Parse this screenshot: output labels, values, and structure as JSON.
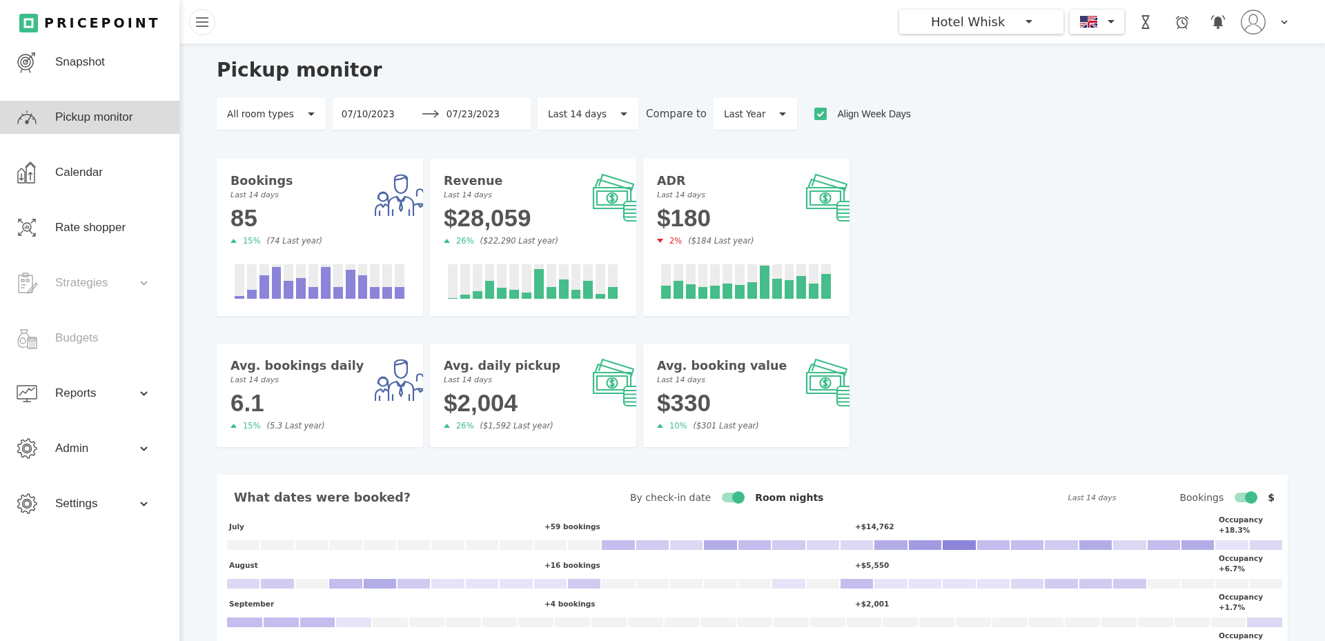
{
  "sidebar": {
    "logo": "PRICEPOINT",
    "items": [
      {
        "label": "Snapshot",
        "selected": false,
        "disabled": false,
        "submenu": false
      },
      {
        "label": "Pickup monitor",
        "selected": true,
        "disabled": false,
        "submenu": false
      },
      {
        "label": "Calendar",
        "selected": false,
        "disabled": false,
        "submenu": false
      },
      {
        "label": "Rate shopper",
        "selected": false,
        "disabled": false,
        "submenu": false
      },
      {
        "label": "Strategies",
        "selected": false,
        "disabled": true,
        "submenu": true
      },
      {
        "label": "Budgets",
        "selected": false,
        "disabled": true,
        "submenu": false
      },
      {
        "label": "Reports",
        "selected": false,
        "disabled": false,
        "submenu": true
      },
      {
        "label": "Admin",
        "selected": false,
        "disabled": false,
        "submenu": true
      },
      {
        "label": "Settings",
        "selected": false,
        "disabled": false,
        "submenu": true
      }
    ]
  },
  "topbar": {
    "hotel": "Hotel Whisk"
  },
  "page": {
    "title": "Pickup monitor"
  },
  "filters": {
    "room_type": "All room types",
    "date_from": "07/10/2023",
    "date_to": "07/23/2023",
    "period": "Last 14 days",
    "compare_label": "Compare to",
    "compare": "Last Year",
    "align_week_days": {
      "label": "Align Week Days",
      "checked": true
    }
  },
  "summary_cards": [
    {
      "kind": "count",
      "title": "Bookings",
      "period": "Last 14 days",
      "value": "85",
      "increase": true,
      "change": "15%",
      "previous": "(74 Last year)"
    },
    {
      "kind": "amount",
      "title": "Revenue",
      "period": "Last 14 days",
      "value": "$28,059",
      "increase": true,
      "change": "26%",
      "previous": "($22,290 Last year)"
    },
    {
      "kind": "amount",
      "title": "ADR",
      "period": "Last 14 days",
      "value": "$180",
      "increase": false,
      "change": "2%",
      "previous": "($184 Last year)"
    }
  ],
  "average_cards": [
    {
      "kind": "count",
      "title": "Avg. bookings daily",
      "period": "Last 14 days",
      "value": "6.1",
      "increase": true,
      "change": "15%",
      "previous": "(5.3 Last year)"
    },
    {
      "kind": "amount",
      "title": "Avg. daily pickup",
      "period": "Last 14 days",
      "value": "$2,004",
      "increase": true,
      "change": "26%",
      "previous": "($1,592 Last year)"
    },
    {
      "kind": "amount",
      "title": "Avg. booking value",
      "period": "Last 14 days",
      "value": "$330",
      "increase": true,
      "change": "10%",
      "previous": "($301 Last year)"
    }
  ],
  "booked_dates": {
    "title": "What dates were booked?",
    "toggles": [
      {
        "left_label": "By check-in date",
        "right_label": "Room nights",
        "on": true
      },
      {
        "left_label": "Bookings",
        "right_label": "$",
        "on": true
      }
    ],
    "period": "Last 14 days",
    "months": [
      {
        "month": "July",
        "bookings": "+59 bookings",
        "revenue": "+$14,762",
        "occupancy_label": "Occupancy",
        "occupancy": "+18.3%",
        "cells": [
          {
            "color": "#f3f3f3"
          },
          {
            "color": "#f3f3f3"
          },
          {
            "color": "#f3f3f3"
          },
          {
            "color": "#f3f3f3"
          },
          {
            "color": "#f3f3f3"
          },
          {
            "color": "#f3f3f3"
          },
          {
            "color": "#f3f3f3"
          },
          {
            "color": "#f3f3f3"
          },
          {
            "color": "#f3f3f3"
          },
          {
            "color": "#f3f3f3"
          },
          {
            "color": "#f3f3f3"
          },
          {
            "color": "#c3beed"
          },
          {
            "color": "#cfcbf1"
          },
          {
            "color": "#dcd9f5"
          },
          {
            "color": "#b3ade7"
          },
          {
            "color": "#c3beed"
          },
          {
            "color": "#cfcbf1"
          },
          {
            "color": "#dcd9f5"
          },
          {
            "color": "#dcd9f5"
          },
          {
            "color": "#b3ade7"
          },
          {
            "color": "#a29be1"
          },
          {
            "color": "#8c85d9"
          },
          {
            "color": "#c3beed"
          },
          {
            "color": "#c3beed"
          },
          {
            "color": "#cfcbf1"
          },
          {
            "color": "#b3ade7"
          },
          {
            "color": "#dcd9f5"
          },
          {
            "color": "#c3beed"
          },
          {
            "color": "#b3ade7"
          },
          {
            "color": "#e6e4f8"
          },
          {
            "color": "#dcd9f5"
          }
        ]
      },
      {
        "month": "August",
        "bookings": "+16 bookings",
        "revenue": "+$5,550",
        "occupancy_label": "Occupancy",
        "occupancy": "+6.7%",
        "cells": [
          {
            "color": "#dcd9f5"
          },
          {
            "color": "#cfcbf1"
          },
          {
            "color": "#f3f3f3"
          },
          {
            "color": "#c3beed"
          },
          {
            "color": "#b3ade7"
          },
          {
            "color": "#cfcbf1"
          },
          {
            "color": "#e6e4f8"
          },
          {
            "color": "#e6e4f8"
          },
          {
            "color": "#e6e4f8"
          },
          {
            "color": "#e6e4f8"
          },
          {
            "color": "#cfcbf1"
          },
          {
            "color": "#f3f3f3"
          },
          {
            "color": "#f3f3f3"
          },
          {
            "color": "#f3f3f3"
          },
          {
            "color": "#f3f3f3"
          },
          {
            "color": "#f3f3f3"
          },
          {
            "color": "#e6e4f8"
          },
          {
            "color": "#f3f3f3"
          },
          {
            "color": "#c3beed"
          },
          {
            "color": "#e6e4f8"
          },
          {
            "color": "#e6e4f8"
          },
          {
            "color": "#e6e4f8"
          },
          {
            "color": "#e6e4f8"
          },
          {
            "color": "#dcd9f5"
          },
          {
            "color": "#cfcbf1"
          },
          {
            "color": "#cfcbf1"
          },
          {
            "color": "#cfcbf1"
          },
          {
            "color": "#f3f3f3"
          },
          {
            "color": "#f3f3f3"
          },
          {
            "color": "#f3f3f3"
          },
          {
            "color": "#f3f3f3"
          }
        ]
      },
      {
        "month": "September",
        "bookings": "+4 bookings",
        "revenue": "+$2,001",
        "occupancy_label": "Occupancy",
        "occupancy": "+1.7%",
        "cells": [
          {
            "color": "#c3beed"
          },
          {
            "color": "#c3beed"
          },
          {
            "color": "#c3beed"
          },
          {
            "color": "#e6e4f8"
          },
          {
            "color": "#f3f3f3"
          },
          {
            "color": "#f3f3f3"
          },
          {
            "color": "#f3f3f3"
          },
          {
            "color": "#f3f3f3"
          },
          {
            "color": "#f3f3f3"
          },
          {
            "color": "#f3f3f3"
          },
          {
            "color": "#f3f3f3"
          },
          {
            "color": "#f3f3f3"
          },
          {
            "color": "#f3f3f3"
          },
          {
            "color": "#f3f3f3"
          },
          {
            "color": "#f3f3f3"
          },
          {
            "color": "#f3f3f3"
          },
          {
            "color": "#f3f3f3"
          },
          {
            "color": "#f3f3f3"
          },
          {
            "color": "#f3f3f3"
          },
          {
            "color": "#f3f3f3"
          },
          {
            "color": "#f3f3f3"
          },
          {
            "color": "#f3f3f3"
          },
          {
            "color": "#f3f3f3"
          },
          {
            "color": "#f3f3f3"
          },
          {
            "color": "#f3f3f3"
          },
          {
            "color": "#f3f3f3"
          },
          {
            "color": "#f3f3f3"
          },
          {
            "color": "#f3f3f3"
          },
          {
            "color": "#dcd9f5"
          }
        ]
      },
      {
        "occupancy_label": "Occupancy"
      }
    ]
  }
}
